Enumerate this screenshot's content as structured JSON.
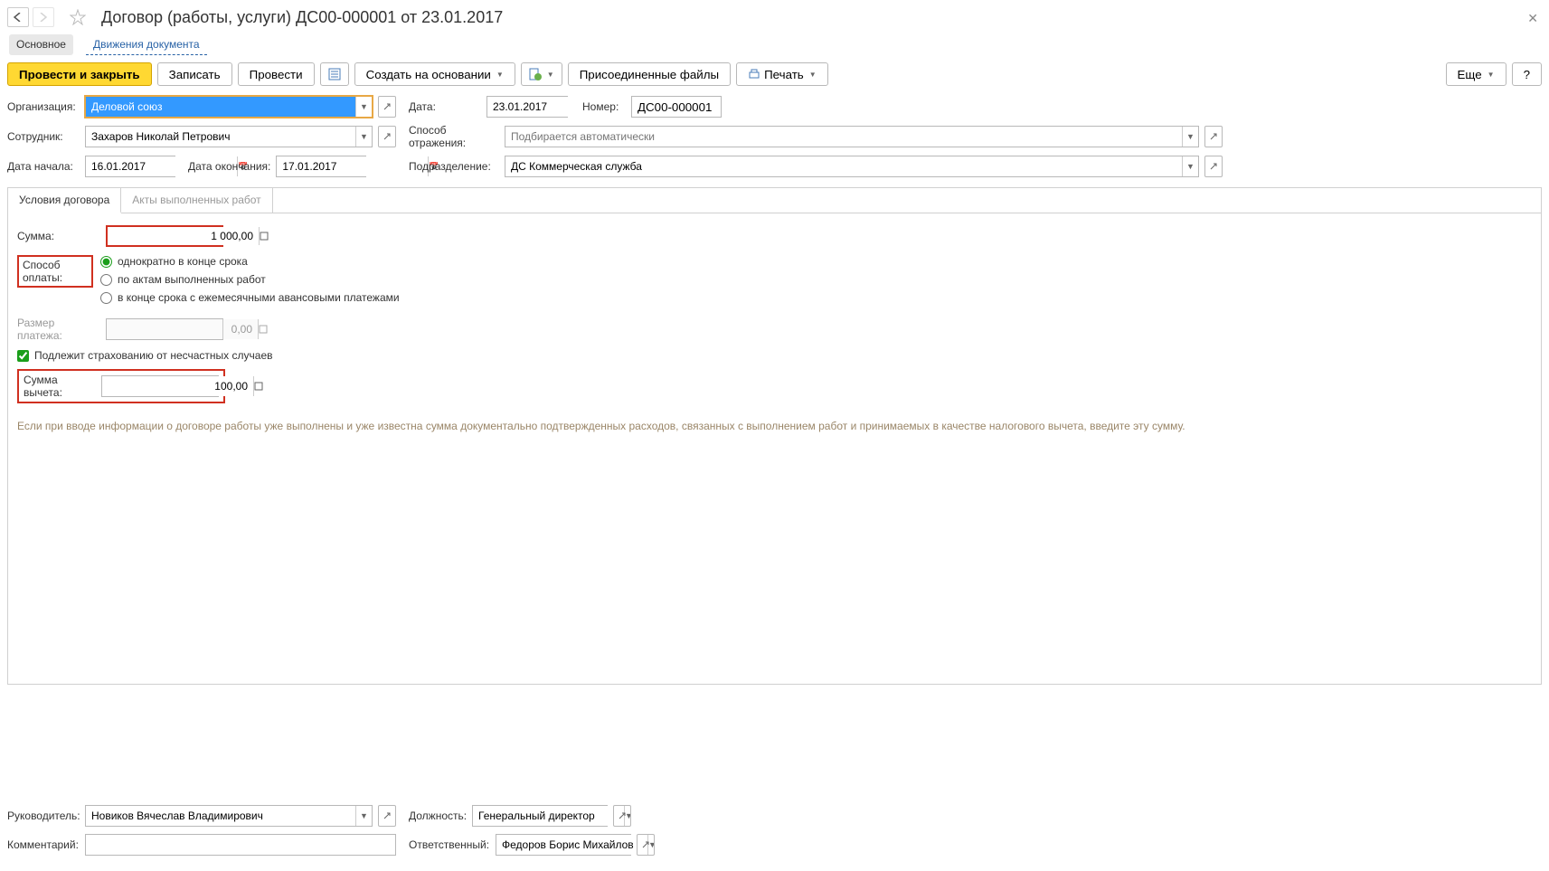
{
  "header": {
    "title": "Договор (работы, услуги) ДС00-000001 от 23.01.2017"
  },
  "subtabs": {
    "main": "Основное",
    "movements": "Движения документа"
  },
  "toolbar": {
    "post_close": "Провести и закрыть",
    "write": "Записать",
    "post": "Провести",
    "create_based": "Создать на основании",
    "attached": "Присоединенные файлы",
    "print": "Печать",
    "more": "Еще",
    "help": "?"
  },
  "fields": {
    "org_label": "Организация:",
    "org_value": "Деловой союз",
    "date_label": "Дата:",
    "date_value": "23.01.2017",
    "number_label": "Номер:",
    "number_value": "ДС00-000001",
    "employee_label": "Сотрудник:",
    "employee_value": "Захаров Николай Петрович",
    "reflect_label": "Способ отражения:",
    "reflect_placeholder": "Подбирается автоматически",
    "start_label": "Дата начала:",
    "start_value": "16.01.2017",
    "end_label": "Дата окончания:",
    "end_value": "17.01.2017",
    "unit_label": "Подразделение:",
    "unit_value": "ДС Коммерческая служба"
  },
  "tabs": {
    "conditions": "Условия договора",
    "acts": "Акты выполненных работ"
  },
  "contract": {
    "sum_label": "Сумма:",
    "sum_value": "1 000,00",
    "payment_label": "Способ оплаты:",
    "opt1": "однократно в конце срока",
    "opt2": "по актам выполненных работ",
    "opt3": "в конце срока с ежемесячными авансовыми платежами",
    "payment_size_label": "Размер платежа:",
    "payment_size_value": "0,00",
    "insurance_label": "Подлежит страхованию от несчастных случаев",
    "deduct_label": "Сумма вычета:",
    "deduct_value": "100,00",
    "help": "Если при вводе информации о договоре работы уже выполнены и уже известна сумма документально подтвержденных расходов, связанных с выполнением работ и принимаемых в качестве налогового вычета, введите эту сумму."
  },
  "footer": {
    "manager_label": "Руководитель:",
    "manager_value": "Новиков Вячеслав Владимирович",
    "position_label": "Должность:",
    "position_value": "Генеральный директор",
    "comment_label": "Комментарий:",
    "comment_value": "",
    "responsible_label": "Ответственный:",
    "responsible_value": "Федоров Борис Михайлов"
  }
}
